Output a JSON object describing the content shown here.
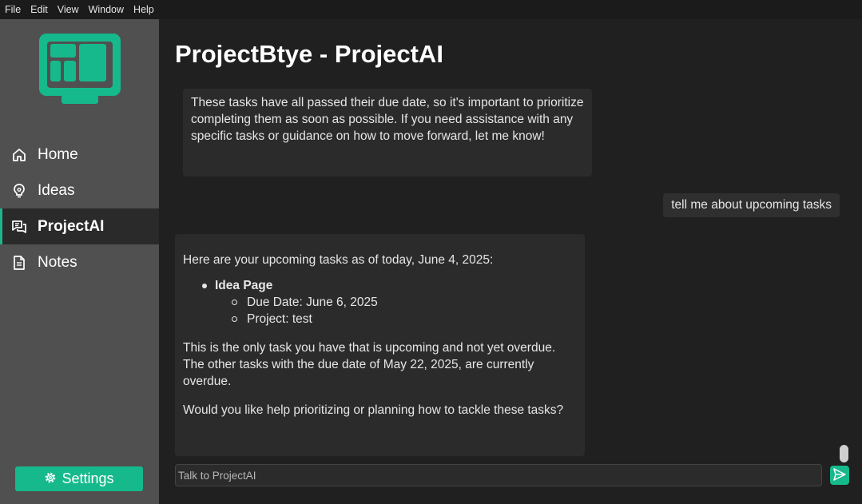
{
  "menubar": {
    "items": [
      "File",
      "Edit",
      "View",
      "Window",
      "Help"
    ]
  },
  "colors": {
    "accent": "#16b98c",
    "sidebar_bg": "#505050",
    "main_bg": "#202020",
    "bubble_bg": "#2b2b2b"
  },
  "sidebar": {
    "logo_icon": "dashboard-monitor-icon",
    "items": [
      {
        "label": "Home",
        "icon": "home-icon",
        "active": false
      },
      {
        "label": "Ideas",
        "icon": "lightbulb-icon",
        "active": false
      },
      {
        "label": "ProjectAI",
        "icon": "chat-icon",
        "active": true
      },
      {
        "label": "Notes",
        "icon": "document-icon",
        "active": false
      }
    ],
    "settings": {
      "label": "Settings",
      "icon": "gear-icon"
    }
  },
  "main": {
    "title": "ProjectBtye - ProjectAI",
    "messages": {
      "assistant_1": "These tasks have all passed their due date, so it's important to prioritize completing them as soon as possible. If you need assistance with any specific tasks or guidance on how to move forward, let me know!",
      "user_1": "tell me about upcoming tasks",
      "assistant_2": {
        "intro": "Here are your upcoming tasks as of today, June 4, 2025:",
        "task": {
          "title": "Idea Page",
          "due": "Due Date: June 6, 2025",
          "project": "Project: test"
        },
        "para_1": "This is the only task you have that is upcoming and not yet overdue. The other tasks with the due date of May 22, 2025, are currently overdue.",
        "para_2": "Would you like help prioritizing or planning how to tackle these tasks?"
      }
    },
    "input": {
      "placeholder": "Talk to ProjectAI",
      "value": ""
    },
    "send_icon": "send-icon"
  }
}
